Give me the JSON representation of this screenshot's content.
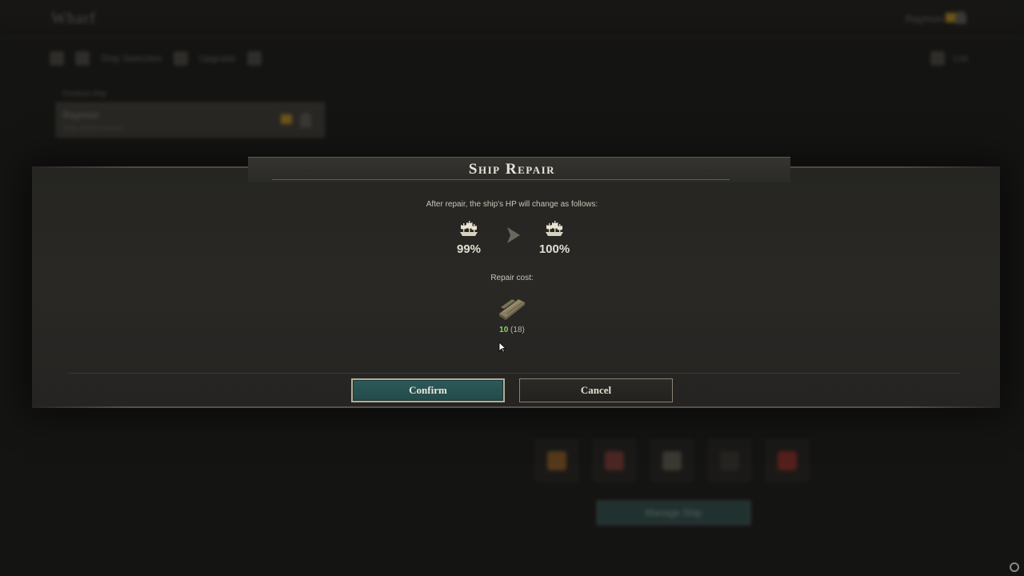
{
  "background": {
    "title": "Wharf",
    "user_name": "Raymon",
    "nav": {
      "ship_selection": "Ship Selection",
      "upgrade": "Upgrade",
      "right_label": "List"
    },
    "card": {
      "label": "Docked ship",
      "name": "Raymon",
      "sub": "Ship status normal"
    },
    "manage_button": "Manage Ship"
  },
  "dialog": {
    "title": "Ship Repair",
    "info": "After repair, the ship's HP will change as follows:",
    "hp_before": "99%",
    "hp_after": "100%",
    "cost_label": "Repair cost:",
    "cost_have": "10",
    "cost_total": "(18)",
    "confirm_label": "Confirm",
    "cancel_label": "Cancel"
  },
  "colors": {
    "confirm_bg": "#2c5a5a",
    "have_green": "#8ed36a",
    "accent_gold": "#b5ad93"
  },
  "icons": [
    "ship-icon",
    "arrow-right-icon",
    "wood-plank-icon",
    "cursor-icon",
    "user-icon",
    "flag-icon"
  ]
}
